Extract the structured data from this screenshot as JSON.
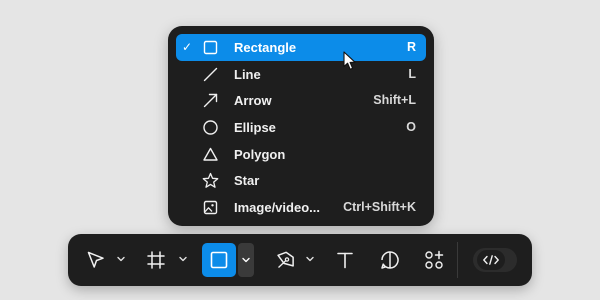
{
  "shape_menu": {
    "items": [
      {
        "label": "Rectangle",
        "shortcut": "R",
        "icon": "rectangle-icon",
        "selected": true
      },
      {
        "label": "Line",
        "shortcut": "L",
        "icon": "line-icon",
        "selected": false
      },
      {
        "label": "Arrow",
        "shortcut": "Shift+L",
        "icon": "arrow-icon",
        "selected": false
      },
      {
        "label": "Ellipse",
        "shortcut": "O",
        "icon": "ellipse-icon",
        "selected": false
      },
      {
        "label": "Polygon",
        "shortcut": "",
        "icon": "polygon-icon",
        "selected": false
      },
      {
        "label": "Star",
        "shortcut": "",
        "icon": "star-icon",
        "selected": false
      },
      {
        "label": "Image/video...",
        "shortcut": "Ctrl+Shift+K",
        "icon": "image-icon",
        "selected": false
      }
    ],
    "checkmark": "✓"
  },
  "toolbar": {
    "tools": [
      {
        "name": "move-tool",
        "icon": "cursor-icon",
        "has_dropdown": true
      },
      {
        "name": "frame-tool",
        "icon": "frame-icon",
        "has_dropdown": true
      },
      {
        "name": "shape-tool",
        "icon": "rectangle-icon",
        "has_dropdown": true,
        "active": true
      },
      {
        "name": "pen-tool",
        "icon": "pen-icon",
        "has_dropdown": true
      },
      {
        "name": "text-tool",
        "icon": "text-icon",
        "has_dropdown": false
      },
      {
        "name": "comment-tool",
        "icon": "comment-icon",
        "has_dropdown": false
      },
      {
        "name": "actions-tool",
        "icon": "actions-icon",
        "has_dropdown": false
      }
    ],
    "dev_mode": {
      "icon": "code-icon",
      "enabled": false
    }
  },
  "colors": {
    "accent": "#0c8ce9",
    "panel": "#1e1e1e",
    "background": "#e5e5e5"
  }
}
